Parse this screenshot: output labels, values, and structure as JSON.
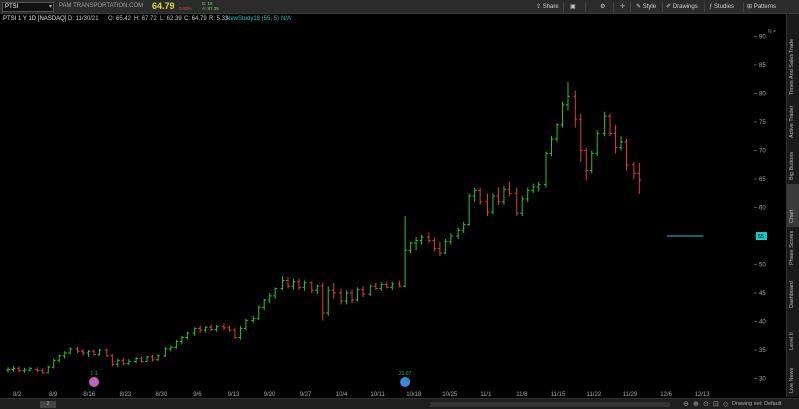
{
  "toolbar": {
    "symbol": "PTSI",
    "company": "PAM TRANSPORTATION.COM",
    "last_price": "64.79",
    "change": "-",
    "change_pct": "0.00%",
    "bid": "B: 16",
    "ask": "A: 87.35",
    "share_label": "Share",
    "style_label": "Style",
    "drawings_label": "Drawings",
    "studies_label": "Studies",
    "patterns_label": "Patterns"
  },
  "infobar": {
    "title": "PTSI 1 Y 1D [NASDAQ]",
    "date": "D: 11/30/21",
    "open": "O: 65.42",
    "high": "H: 67.72",
    "low": "L: 62.39",
    "close": "C: 64.79",
    "range": "R: 5.33",
    "study": "NewStudy18 (55, 5)",
    "study_value": "N/A"
  },
  "right_tabs": [
    "Trade",
    "Times And Sales",
    "Active Trader",
    "Big Buttons",
    "Chart",
    "Phase Scores",
    "Dashboard",
    "Level II",
    "Live News"
  ],
  "active_tab": "Chart",
  "price_axis": {
    "labels": [
      "90",
      "85",
      "80",
      "75",
      "70",
      "65",
      "60",
      "55",
      "50",
      "45",
      "40",
      "35",
      "30"
    ],
    "current_badge": "55",
    "top_label": "N ="
  },
  "date_axis": {
    "labels": [
      "8/2",
      "8/9",
      "8/16",
      "8/23",
      "8/30",
      "9/6",
      "9/13",
      "9/20",
      "9/27",
      "10/4",
      "10/11",
      "10/18",
      "10/25",
      "11/1",
      "11/8",
      "11/15",
      "11/22",
      "11/29",
      "12/6",
      "12/13"
    ]
  },
  "events": [
    {
      "label": "1.1",
      "icon": "split-icon",
      "color": "#c060c0"
    },
    {
      "label": "21.07",
      "icon": "earnings-icon",
      "color": "#3a8ad8"
    }
  ],
  "bottom": {
    "thumb_label": "2",
    "drawing_set": "Drawing set: Default"
  },
  "colors": {
    "up": "#29c229",
    "down": "#e23b3b",
    "study_line": "#17c9c9",
    "background": "#000000"
  },
  "chart_data": {
    "type": "candlestick-bars",
    "ylim": [
      28,
      92
    ],
    "xlim": [
      0,
      20
    ],
    "bars": [
      {
        "x": 0.0,
        "o": 31.5,
        "h": 32.0,
        "l": 31.0,
        "c": 31.6
      },
      {
        "x": 0.15,
        "o": 31.6,
        "h": 32.2,
        "l": 31.2,
        "c": 31.8
      },
      {
        "x": 0.3,
        "o": 31.8,
        "h": 32.1,
        "l": 31.1,
        "c": 31.4
      },
      {
        "x": 0.45,
        "o": 31.4,
        "h": 31.9,
        "l": 31.0,
        "c": 31.5
      },
      {
        "x": 0.6,
        "o": 31.5,
        "h": 32.0,
        "l": 31.2,
        "c": 31.8
      },
      {
        "x": 0.8,
        "o": 31.6,
        "h": 32.0,
        "l": 31.2,
        "c": 31.4
      },
      {
        "x": 0.95,
        "o": 31.4,
        "h": 31.8,
        "l": 30.9,
        "c": 31.0
      },
      {
        "x": 1.1,
        "o": 31.0,
        "h": 32.3,
        "l": 30.9,
        "c": 32.0
      },
      {
        "x": 1.25,
        "o": 32.0,
        "h": 33.5,
        "l": 31.8,
        "c": 33.2
      },
      {
        "x": 1.4,
        "o": 33.2,
        "h": 34.2,
        "l": 32.8,
        "c": 34.0
      },
      {
        "x": 1.55,
        "o": 34.0,
        "h": 34.8,
        "l": 33.5,
        "c": 34.5
      },
      {
        "x": 1.7,
        "o": 34.5,
        "h": 35.5,
        "l": 34.2,
        "c": 35.2
      },
      {
        "x": 1.9,
        "o": 35.2,
        "h": 35.6,
        "l": 34.5,
        "c": 34.8
      },
      {
        "x": 2.05,
        "o": 34.8,
        "h": 35.2,
        "l": 34.0,
        "c": 34.5
      },
      {
        "x": 2.2,
        "o": 34.5,
        "h": 35.0,
        "l": 33.8,
        "c": 34.8
      },
      {
        "x": 2.35,
        "o": 34.8,
        "h": 35.0,
        "l": 34.0,
        "c": 34.2
      },
      {
        "x": 2.5,
        "o": 34.2,
        "h": 35.2,
        "l": 34.0,
        "c": 35.0
      },
      {
        "x": 2.7,
        "o": 35.0,
        "h": 35.3,
        "l": 33.8,
        "c": 34.0
      },
      {
        "x": 2.85,
        "o": 34.0,
        "h": 34.3,
        "l": 32.2,
        "c": 32.5
      },
      {
        "x": 3.0,
        "o": 32.5,
        "h": 33.5,
        "l": 32.0,
        "c": 33.2
      },
      {
        "x": 3.15,
        "o": 33.2,
        "h": 33.6,
        "l": 32.3,
        "c": 32.6
      },
      {
        "x": 3.3,
        "o": 32.6,
        "h": 33.4,
        "l": 32.4,
        "c": 33.0
      },
      {
        "x": 3.5,
        "o": 33.0,
        "h": 33.8,
        "l": 32.7,
        "c": 33.5
      },
      {
        "x": 3.65,
        "o": 33.5,
        "h": 33.9,
        "l": 32.8,
        "c": 33.0
      },
      {
        "x": 3.8,
        "o": 33.0,
        "h": 34.0,
        "l": 32.9,
        "c": 33.8
      },
      {
        "x": 3.95,
        "o": 33.8,
        "h": 34.2,
        "l": 33.0,
        "c": 33.3
      },
      {
        "x": 4.1,
        "o": 33.3,
        "h": 34.3,
        "l": 33.1,
        "c": 34.0
      },
      {
        "x": 4.3,
        "o": 34.0,
        "h": 35.5,
        "l": 33.8,
        "c": 35.2
      },
      {
        "x": 4.45,
        "o": 35.2,
        "h": 35.8,
        "l": 34.8,
        "c": 35.5
      },
      {
        "x": 4.6,
        "o": 35.5,
        "h": 36.8,
        "l": 35.2,
        "c": 36.5
      },
      {
        "x": 4.75,
        "o": 36.5,
        "h": 37.5,
        "l": 36.0,
        "c": 37.2
      },
      {
        "x": 4.9,
        "o": 37.2,
        "h": 38.2,
        "l": 36.8,
        "c": 38.0
      },
      {
        "x": 5.1,
        "o": 38.0,
        "h": 39.0,
        "l": 37.5,
        "c": 38.8
      },
      {
        "x": 5.25,
        "o": 38.8,
        "h": 39.3,
        "l": 38.0,
        "c": 38.5
      },
      {
        "x": 5.4,
        "o": 38.5,
        "h": 39.2,
        "l": 38.1,
        "c": 39.0
      },
      {
        "x": 5.55,
        "o": 39.0,
        "h": 39.5,
        "l": 38.3,
        "c": 38.6
      },
      {
        "x": 5.7,
        "o": 38.6,
        "h": 39.4,
        "l": 38.2,
        "c": 39.1
      },
      {
        "x": 5.9,
        "o": 39.1,
        "h": 39.7,
        "l": 38.5,
        "c": 38.9
      },
      {
        "x": 6.05,
        "o": 38.9,
        "h": 39.3,
        "l": 38.2,
        "c": 38.5
      },
      {
        "x": 6.2,
        "o": 38.5,
        "h": 38.9,
        "l": 37.0,
        "c": 37.2
      },
      {
        "x": 6.35,
        "o": 37.2,
        "h": 39.2,
        "l": 36.8,
        "c": 38.8
      },
      {
        "x": 6.5,
        "o": 38.8,
        "h": 40.5,
        "l": 38.5,
        "c": 40.2
      },
      {
        "x": 6.7,
        "o": 40.2,
        "h": 41.0,
        "l": 39.8,
        "c": 40.5
      },
      {
        "x": 6.85,
        "o": 40.5,
        "h": 42.8,
        "l": 40.3,
        "c": 42.5
      },
      {
        "x": 7.0,
        "o": 42.5,
        "h": 44.0,
        "l": 42.0,
        "c": 43.8
      },
      {
        "x": 7.15,
        "o": 43.8,
        "h": 45.0,
        "l": 43.2,
        "c": 44.5
      },
      {
        "x": 7.3,
        "o": 44.5,
        "h": 46.0,
        "l": 44.0,
        "c": 45.8
      },
      {
        "x": 7.5,
        "o": 45.8,
        "h": 48.0,
        "l": 45.5,
        "c": 47.2
      },
      {
        "x": 7.65,
        "o": 47.2,
        "h": 47.8,
        "l": 45.8,
        "c": 46.2
      },
      {
        "x": 7.8,
        "o": 46.2,
        "h": 47.5,
        "l": 45.6,
        "c": 47.0
      },
      {
        "x": 7.95,
        "o": 47.0,
        "h": 47.5,
        "l": 45.5,
        "c": 46.0
      },
      {
        "x": 8.1,
        "o": 46.0,
        "h": 47.2,
        "l": 45.4,
        "c": 46.8
      },
      {
        "x": 8.3,
        "o": 46.8,
        "h": 47.0,
        "l": 45.0,
        "c": 45.5
      },
      {
        "x": 8.45,
        "o": 45.5,
        "h": 46.5,
        "l": 44.8,
        "c": 46.2
      },
      {
        "x": 8.6,
        "o": 46.2,
        "h": 46.8,
        "l": 40.2,
        "c": 41.5
      },
      {
        "x": 8.75,
        "o": 41.5,
        "h": 46.2,
        "l": 41.0,
        "c": 45.5
      },
      {
        "x": 8.9,
        "o": 45.5,
        "h": 46.8,
        "l": 44.0,
        "c": 45.0
      },
      {
        "x": 9.1,
        "o": 45.0,
        "h": 45.8,
        "l": 43.0,
        "c": 43.6
      },
      {
        "x": 9.25,
        "o": 43.6,
        "h": 45.5,
        "l": 43.0,
        "c": 45.0
      },
      {
        "x": 9.4,
        "o": 45.0,
        "h": 45.6,
        "l": 43.2,
        "c": 43.8
      },
      {
        "x": 9.55,
        "o": 43.8,
        "h": 46.0,
        "l": 43.5,
        "c": 45.6
      },
      {
        "x": 9.7,
        "o": 45.6,
        "h": 46.2,
        "l": 44.3,
        "c": 44.8
      },
      {
        "x": 9.9,
        "o": 44.8,
        "h": 46.5,
        "l": 44.5,
        "c": 46.2
      },
      {
        "x": 10.05,
        "o": 46.2,
        "h": 46.8,
        "l": 45.5,
        "c": 45.8
      },
      {
        "x": 10.2,
        "o": 45.8,
        "h": 46.9,
        "l": 45.4,
        "c": 46.5
      },
      {
        "x": 10.35,
        "o": 46.5,
        "h": 47.0,
        "l": 45.8,
        "c": 46.0
      },
      {
        "x": 10.5,
        "o": 46.0,
        "h": 47.0,
        "l": 45.5,
        "c": 46.6
      },
      {
        "x": 10.7,
        "o": 46.6,
        "h": 47.2,
        "l": 46.0,
        "c": 46.2
      },
      {
        "x": 10.85,
        "o": 46.2,
        "h": 58.5,
        "l": 46.0,
        "c": 52.5
      },
      {
        "x": 11.0,
        "o": 52.5,
        "h": 54.0,
        "l": 52.0,
        "c": 53.8
      },
      {
        "x": 11.15,
        "o": 53.8,
        "h": 54.8,
        "l": 52.5,
        "c": 54.2
      },
      {
        "x": 11.3,
        "o": 54.2,
        "h": 55.2,
        "l": 53.5,
        "c": 54.8
      },
      {
        "x": 11.5,
        "o": 54.8,
        "h": 55.6,
        "l": 53.8,
        "c": 54.2
      },
      {
        "x": 11.65,
        "o": 54.2,
        "h": 54.8,
        "l": 52.3,
        "c": 52.8
      },
      {
        "x": 11.8,
        "o": 52.8,
        "h": 54.0,
        "l": 51.5,
        "c": 52.0
      },
      {
        "x": 11.95,
        "o": 52.0,
        "h": 54.5,
        "l": 51.8,
        "c": 54.0
      },
      {
        "x": 12.1,
        "o": 54.0,
        "h": 55.5,
        "l": 53.5,
        "c": 55.0
      },
      {
        "x": 12.3,
        "o": 55.0,
        "h": 56.5,
        "l": 54.5,
        "c": 56.0
      },
      {
        "x": 12.45,
        "o": 56.0,
        "h": 57.5,
        "l": 55.5,
        "c": 57.0
      },
      {
        "x": 12.6,
        "o": 57.0,
        "h": 62.5,
        "l": 56.8,
        "c": 62.0
      },
      {
        "x": 12.75,
        "o": 62.0,
        "h": 63.5,
        "l": 61.0,
        "c": 63.0
      },
      {
        "x": 12.9,
        "o": 63.0,
        "h": 63.5,
        "l": 60.5,
        "c": 61.0
      },
      {
        "x": 13.1,
        "o": 61.0,
        "h": 62.5,
        "l": 58.5,
        "c": 59.2
      },
      {
        "x": 13.25,
        "o": 59.2,
        "h": 62.5,
        "l": 58.8,
        "c": 62.0
      },
      {
        "x": 13.4,
        "o": 62.0,
        "h": 63.5,
        "l": 60.5,
        "c": 61.0
      },
      {
        "x": 13.55,
        "o": 61.0,
        "h": 63.8,
        "l": 60.5,
        "c": 63.2
      },
      {
        "x": 13.7,
        "o": 63.2,
        "h": 64.5,
        "l": 62.0,
        "c": 62.5
      },
      {
        "x": 13.9,
        "o": 62.5,
        "h": 63.5,
        "l": 58.5,
        "c": 59.0
      },
      {
        "x": 14.05,
        "o": 59.0,
        "h": 62.0,
        "l": 58.5,
        "c": 61.5
      },
      {
        "x": 14.2,
        "o": 61.5,
        "h": 63.5,
        "l": 61.0,
        "c": 63.0
      },
      {
        "x": 14.35,
        "o": 63.0,
        "h": 64.2,
        "l": 62.5,
        "c": 63.6
      },
      {
        "x": 14.5,
        "o": 63.6,
        "h": 64.5,
        "l": 62.8,
        "c": 64.0
      },
      {
        "x": 14.7,
        "o": 64.0,
        "h": 69.8,
        "l": 63.5,
        "c": 69.5
      },
      {
        "x": 14.85,
        "o": 69.5,
        "h": 72.5,
        "l": 69.0,
        "c": 72.0
      },
      {
        "x": 15.0,
        "o": 72.0,
        "h": 74.8,
        "l": 71.5,
        "c": 74.5
      },
      {
        "x": 15.15,
        "o": 74.5,
        "h": 78.5,
        "l": 74.0,
        "c": 78.0
      },
      {
        "x": 15.3,
        "o": 78.0,
        "h": 82.0,
        "l": 77.0,
        "c": 79.5
      },
      {
        "x": 15.5,
        "o": 79.5,
        "h": 80.5,
        "l": 74.0,
        "c": 75.5
      },
      {
        "x": 15.65,
        "o": 75.5,
        "h": 76.5,
        "l": 68.0,
        "c": 70.0
      },
      {
        "x": 15.8,
        "o": 70.0,
        "h": 70.5,
        "l": 64.8,
        "c": 66.5
      },
      {
        "x": 15.95,
        "o": 66.5,
        "h": 70.0,
        "l": 66.0,
        "c": 69.5
      },
      {
        "x": 16.1,
        "o": 69.5,
        "h": 73.5,
        "l": 69.0,
        "c": 73.0
      },
      {
        "x": 16.3,
        "o": 73.0,
        "h": 76.8,
        "l": 72.5,
        "c": 76.0
      },
      {
        "x": 16.45,
        "o": 76.0,
        "h": 76.5,
        "l": 72.5,
        "c": 73.0
      },
      {
        "x": 16.6,
        "o": 73.0,
        "h": 74.5,
        "l": 69.5,
        "c": 70.5
      },
      {
        "x": 16.75,
        "o": 70.5,
        "h": 72.5,
        "l": 70.0,
        "c": 71.5
      },
      {
        "x": 16.9,
        "o": 71.5,
        "h": 72.0,
        "l": 66.5,
        "c": 67.5
      },
      {
        "x": 17.1,
        "o": 67.5,
        "h": 68.0,
        "l": 65.0,
        "c": 66.0
      },
      {
        "x": 17.25,
        "o": 66.0,
        "h": 67.8,
        "l": 62.4,
        "c": 64.8
      }
    ],
    "study_line": {
      "name": "NewStudy18 (55, 5)",
      "x0": 18.0,
      "x1": 19.0,
      "y": 55.0
    }
  }
}
